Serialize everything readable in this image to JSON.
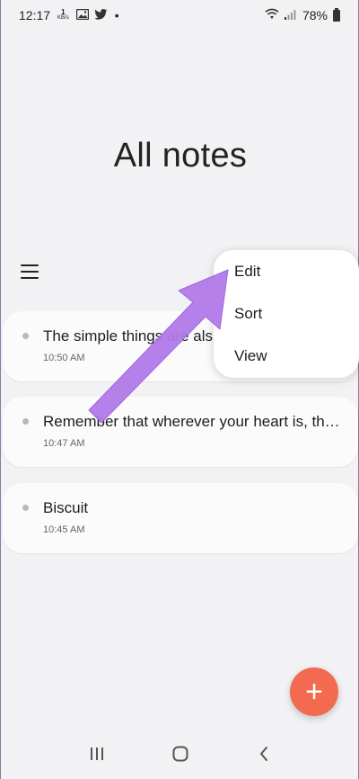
{
  "status_bar": {
    "time": "12:17",
    "speed_value": "1",
    "speed_unit": "KB/s",
    "dot": "•",
    "battery": "78%"
  },
  "page": {
    "title": "All notes"
  },
  "notes": [
    {
      "title": "The simple things are als",
      "time": "10:50 AM"
    },
    {
      "title": "Remember that wherever your heart is, th…",
      "time": "10:47 AM"
    },
    {
      "title": "Biscuit",
      "time": "10:45 AM"
    }
  ],
  "menu": {
    "items": [
      {
        "label": "Edit"
      },
      {
        "label": "Sort"
      },
      {
        "label": "View"
      }
    ]
  },
  "fab": {
    "icon": "plus",
    "label": "+"
  },
  "colors": {
    "background": "#f2f2f4",
    "card": "#fbfbfc",
    "accent": "#f26a50",
    "annotation_arrow": "#b27ae8"
  },
  "icons": [
    "image-icon",
    "twitter-icon",
    "wifi-icon",
    "signal-icon",
    "battery-icon",
    "menu-icon",
    "recent-apps-icon",
    "home-icon",
    "back-icon"
  ]
}
